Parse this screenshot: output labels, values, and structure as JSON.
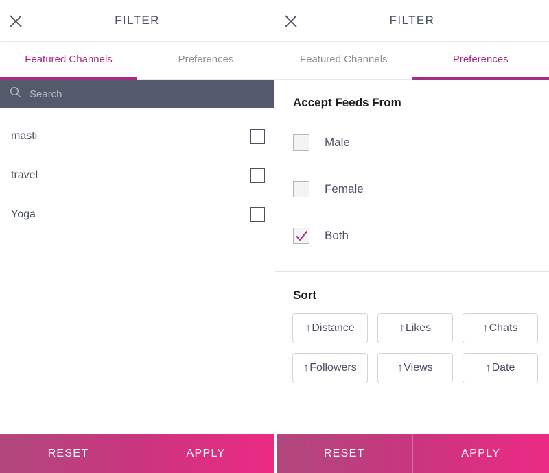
{
  "screens": [
    {
      "id": "featured-channels-screen",
      "titlebar": {
        "close_icon": "close-icon",
        "title": "FILTER"
      },
      "tabs": [
        {
          "label": "Featured Channels",
          "active": true
        },
        {
          "label": "Preferences",
          "active": false
        }
      ],
      "search": {
        "icon": "search-icon",
        "placeholder": "Search",
        "value": ""
      },
      "channels": [
        {
          "label": "masti",
          "checked": false
        },
        {
          "label": "travel",
          "checked": false
        },
        {
          "label": "Yoga",
          "checked": false
        }
      ]
    },
    {
      "id": "preferences-screen",
      "titlebar": {
        "close_icon": "close-icon",
        "title": "FILTER"
      },
      "tabs": [
        {
          "label": "Featured Channels",
          "active": false
        },
        {
          "label": "Preferences",
          "active": true
        }
      ],
      "accept_feeds": {
        "heading": "Accept Feeds From",
        "options": [
          {
            "label": "Male",
            "checked": false
          },
          {
            "label": "Female",
            "checked": false
          },
          {
            "label": "Both",
            "checked": true
          }
        ]
      },
      "sort": {
        "heading": "Sort",
        "options": [
          {
            "arrow": "↑",
            "label": "Distance"
          },
          {
            "arrow": "↑",
            "label": "Likes"
          },
          {
            "arrow": "↑",
            "label": "Chats"
          },
          {
            "arrow": "↑",
            "label": "Followers"
          },
          {
            "arrow": "↑",
            "label": "Views"
          },
          {
            "arrow": "↑",
            "label": "Date"
          }
        ]
      }
    }
  ],
  "actionbar": {
    "left": {
      "reset_label": "RESET",
      "apply_label": "APPLY"
    },
    "right": {
      "reset_label": "RESET",
      "apply_label": "APPLY"
    }
  },
  "colors": {
    "accent_magenta": "#a82b82",
    "slate_text": "#4a5161",
    "search_bg": "#545a6b",
    "muted_text": "#8d8d93",
    "action_gradient_start": "#b0487d",
    "action_gradient_mid": "#c9357f",
    "action_gradient_end": "#ec2a85",
    "border_light": "#e8e8ea",
    "sort_border": "#d2d4d9"
  }
}
